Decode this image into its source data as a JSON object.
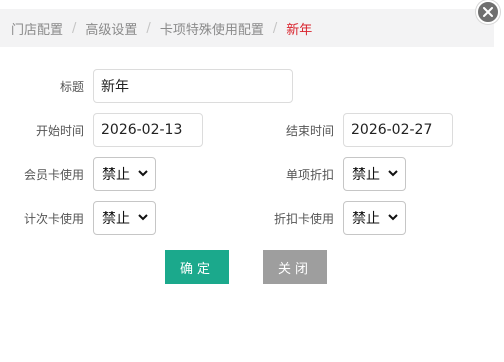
{
  "breadcrumb": [
    "门店配置",
    "高级设置",
    "卡项特殊使用配置",
    "新年"
  ],
  "breadcrumb_separator": "/",
  "form": {
    "title_label": "标题",
    "title_value": "新年",
    "start_label": "开始时间",
    "start_value": "2026-02-13",
    "end_label": "结束时间",
    "end_value": "2026-02-27",
    "member_card_label": "会员卡使用",
    "member_card_value": "禁止",
    "single_discount_label": "单项折扣",
    "single_discount_value": "禁止",
    "count_card_label": "计次卡使用",
    "count_card_value": "禁止",
    "discount_card_label": "折扣卡使用",
    "discount_card_value": "禁止"
  },
  "buttons": {
    "confirm": "确定",
    "close": "关闭"
  },
  "colors": {
    "primary": "#1ba98c",
    "active_crumb": "#d9232d",
    "close_button": "#6f6f6f"
  },
  "icons": {
    "close": "close-icon",
    "select": "chevron-down-icon"
  }
}
